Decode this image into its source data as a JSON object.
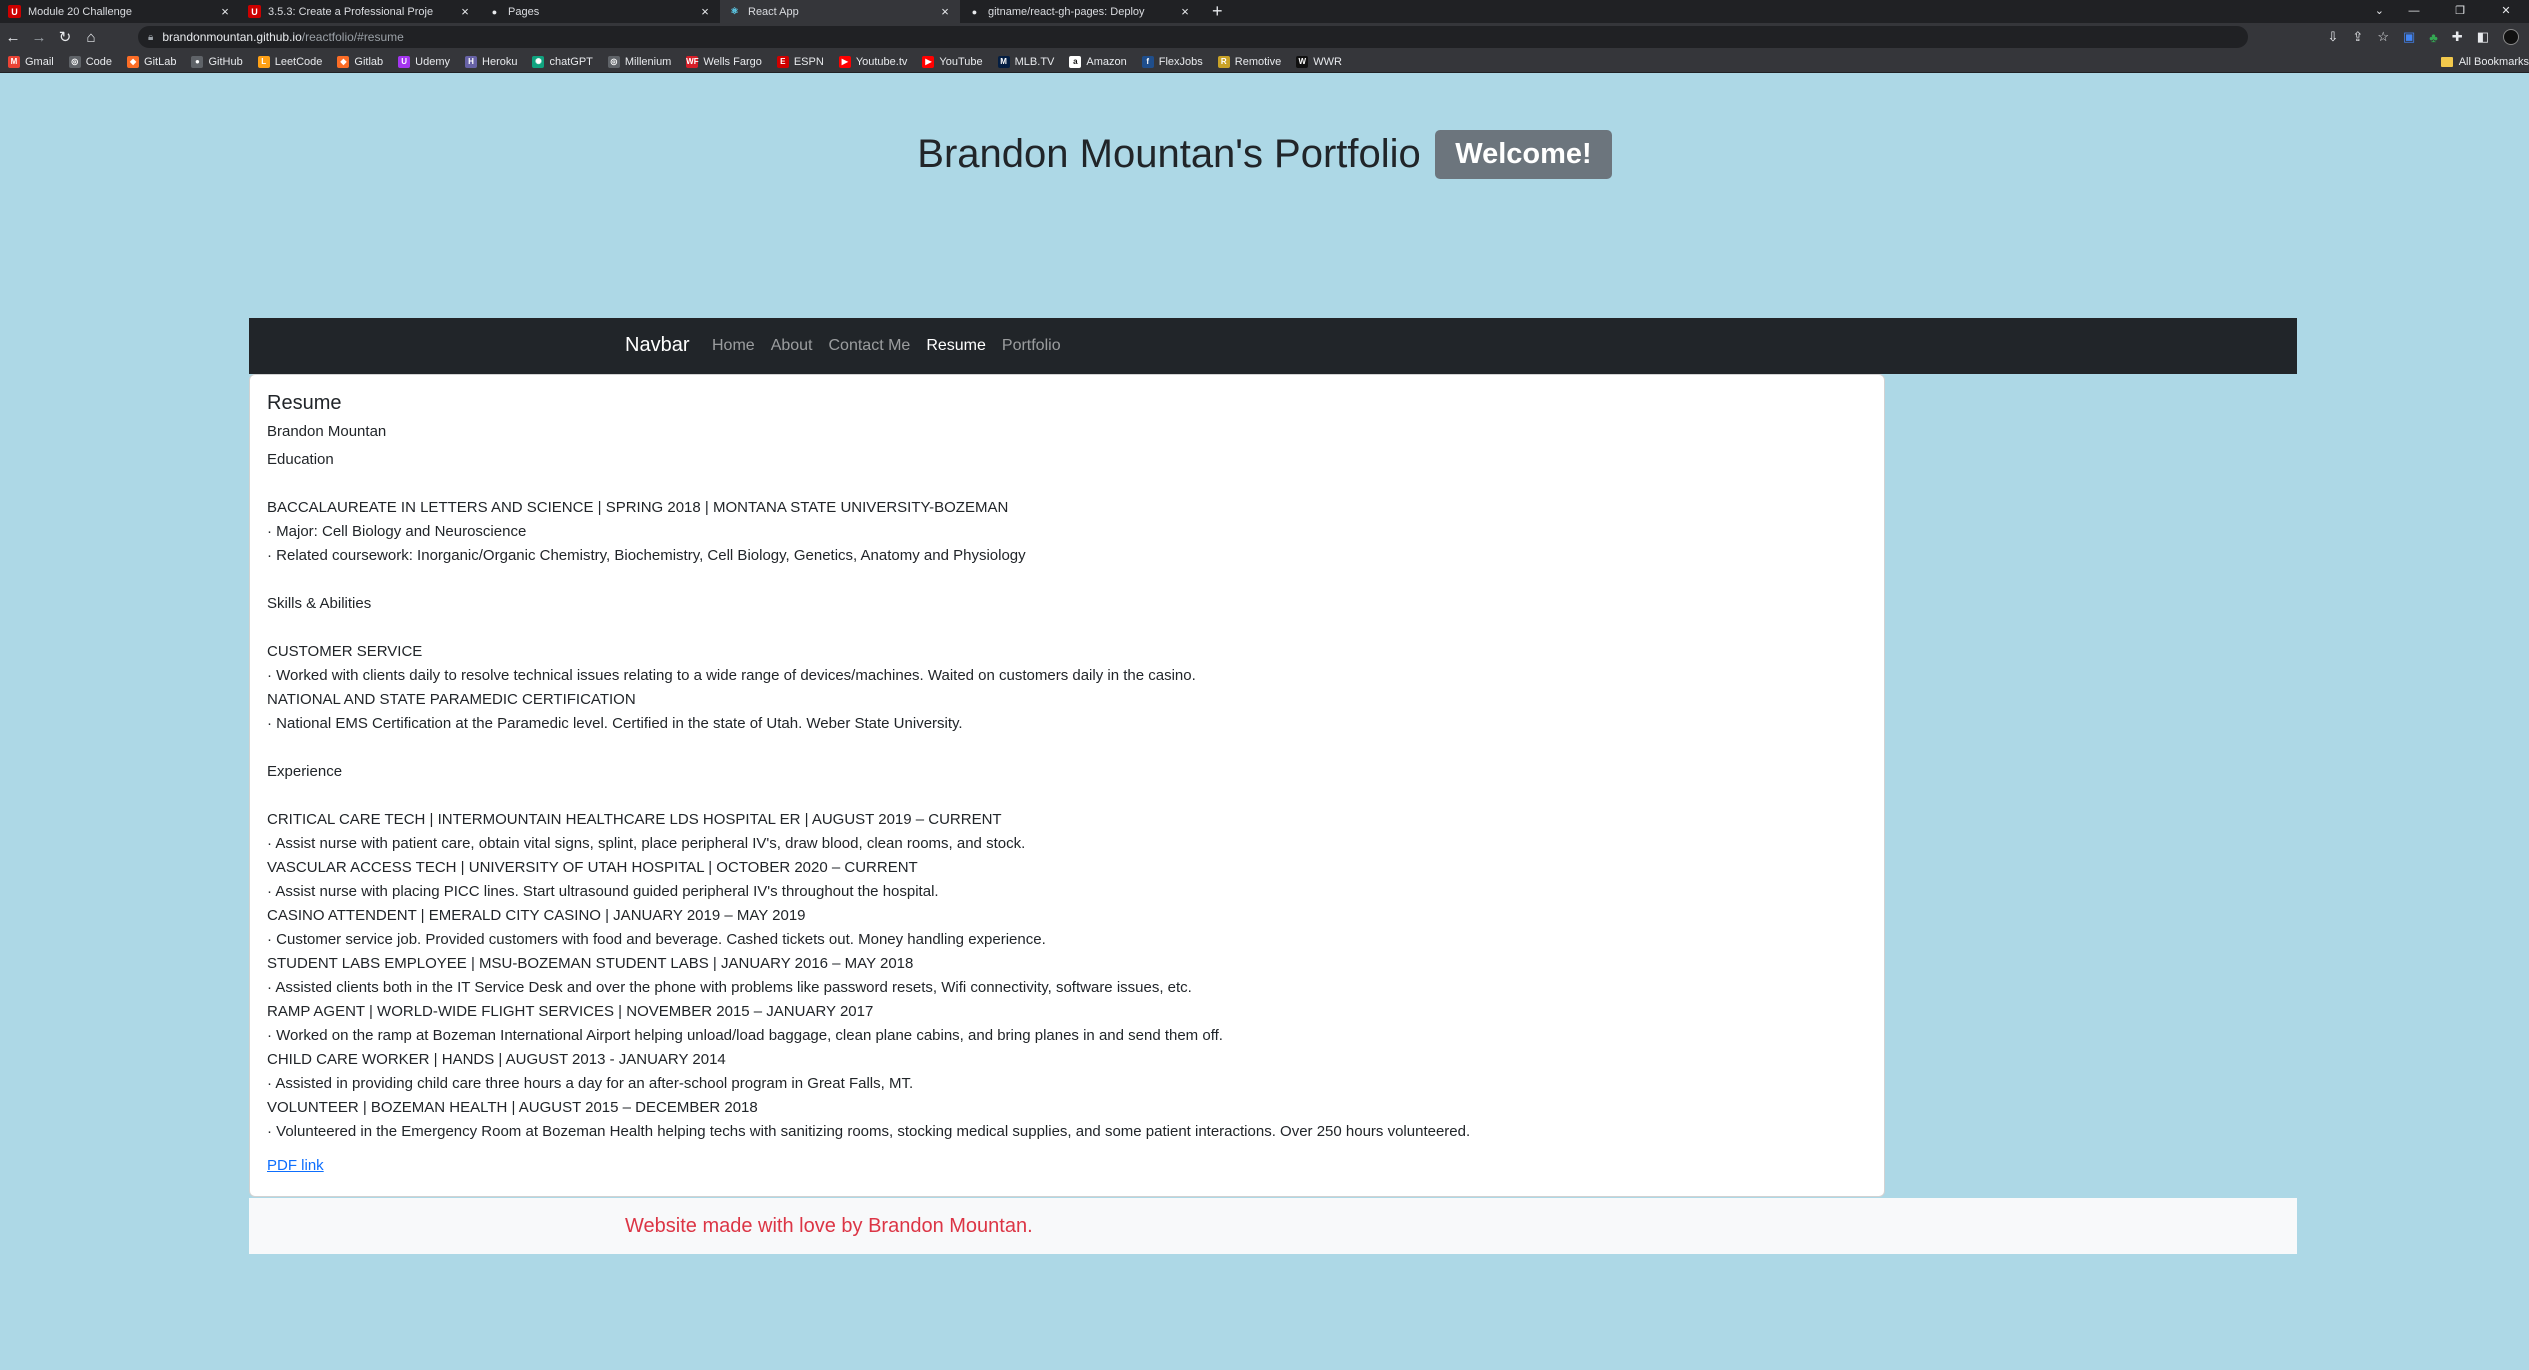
{
  "browser": {
    "tabs": [
      {
        "title": "Module 20 Challenge",
        "icon": "u-logo",
        "color": "#cc0000",
        "glyph": "U"
      },
      {
        "title": "3.5.3: Create a Professional Proje",
        "icon": "u-logo",
        "color": "#cc0000",
        "glyph": "U"
      },
      {
        "title": "Pages",
        "icon": "github-icon",
        "color": "#e8eaed",
        "glyph": "●"
      },
      {
        "title": "React App",
        "icon": "react-icon",
        "color": "#61dafb",
        "glyph": "⚛"
      },
      {
        "title": "gitname/react-gh-pages: Deploy",
        "icon": "github-icon",
        "color": "#e8eaed",
        "glyph": "●"
      }
    ],
    "new_tab": "+",
    "url_host": "brandonmountan.github.io",
    "url_path": "/reactfolio/#resume",
    "bookmarks": [
      {
        "label": "Gmail",
        "color": "#ea4335",
        "glyph": "M"
      },
      {
        "label": "Code",
        "color": "#5f6368",
        "glyph": "◎"
      },
      {
        "label": "GitLab",
        "color": "#fc6d26",
        "glyph": "◆"
      },
      {
        "label": "GitHub",
        "color": "#5f6368",
        "glyph": "●"
      },
      {
        "label": "LeetCode",
        "color": "#ffa116",
        "glyph": "L"
      },
      {
        "label": "Gitlab",
        "color": "#fc6d26",
        "glyph": "◆"
      },
      {
        "label": "Udemy",
        "color": "#a435f0",
        "glyph": "U"
      },
      {
        "label": "Heroku",
        "color": "#6762a6",
        "glyph": "H"
      },
      {
        "label": "chatGPT",
        "color": "#10a37f",
        "glyph": "✺"
      },
      {
        "label": "Millenium",
        "color": "#5f6368",
        "glyph": "◎"
      },
      {
        "label": "Wells Fargo",
        "color": "#d71e28",
        "glyph": "WF"
      },
      {
        "label": "ESPN",
        "color": "#d00000",
        "glyph": "E"
      },
      {
        "label": "Youtube.tv",
        "color": "#ff0000",
        "glyph": "▶"
      },
      {
        "label": "YouTube",
        "color": "#ff0000",
        "glyph": "▶"
      },
      {
        "label": "MLB.TV",
        "color": "#041e42",
        "glyph": "M"
      },
      {
        "label": "Amazon",
        "color": "#ffffff",
        "glyph": "a"
      },
      {
        "label": "FlexJobs",
        "color": "#1f4e8c",
        "glyph": "f"
      },
      {
        "label": "Remotive",
        "color": "#c9a227",
        "glyph": "R"
      },
      {
        "label": "WWR",
        "color": "#111111",
        "glyph": "W"
      }
    ],
    "all_bookmarks": "All Bookmarks"
  },
  "header": {
    "title": "Brandon Mountan's Portfolio",
    "badge": "Welcome!"
  },
  "navbar": {
    "brand": "Navbar",
    "links": [
      {
        "label": "Home",
        "active": false
      },
      {
        "label": "About",
        "active": false
      },
      {
        "label": "Contact Me",
        "active": false
      },
      {
        "label": "Resume",
        "active": true
      },
      {
        "label": "Portfolio",
        "active": false
      }
    ]
  },
  "resume": {
    "title": "Resume",
    "name": "Brandon Mountan",
    "lines": [
      "Education",
      "",
      "BACCALAUREATE IN LETTERS AND SCIENCE | SPRING 2018 | MONTANA STATE UNIVERSITY-BOZEMAN",
      "· Major: Cell Biology and Neuroscience",
      "· Related coursework: Inorganic/Organic Chemistry, Biochemistry, Cell Biology, Genetics, Anatomy and Physiology",
      "",
      "Skills & Abilities",
      "",
      "CUSTOMER SERVICE",
      "· Worked with clients daily to resolve technical issues relating to a wide range of devices/machines. Waited on customers daily in the casino.",
      "NATIONAL AND STATE PARAMEDIC CERTIFICATION",
      "· National EMS Certification at the Paramedic level. Certified in the state of Utah. Weber State University.",
      "",
      "Experience",
      "",
      "CRITICAL CARE TECH | INTERMOUNTAIN HEALTHCARE LDS HOSPITAL ER | AUGUST 2019 – CURRENT",
      "· Assist nurse with patient care, obtain vital signs, splint, place peripheral IV's, draw blood, clean rooms, and stock.",
      "VASCULAR ACCESS TECH | UNIVERSITY OF UTAH HOSPITAL | OCTOBER 2020 – CURRENT",
      "· Assist nurse with placing PICC lines. Start ultrasound guided peripheral IV's throughout the hospital.",
      "CASINO ATTENDENT | EMERALD CITY CASINO | JANUARY 2019 – MAY 2019",
      "· Customer service job. Provided customers with food and beverage. Cashed tickets out. Money handling experience.",
      "STUDENT LABS EMPLOYEE | MSU-BOZEMAN STUDENT LABS | JANUARY 2016 – MAY 2018",
      "· Assisted clients both in the IT Service Desk and over the phone with problems like password resets, Wifi connectivity, software issues, etc.",
      "RAMP AGENT | WORLD-WIDE FLIGHT SERVICES | NOVEMBER 2015 – JANUARY 2017",
      "· Worked on the ramp at Bozeman International Airport helping unload/load baggage, clean plane cabins, and bring planes in and send them off.",
      "CHILD CARE WORKER | HANDS | AUGUST 2013 - JANUARY 2014",
      "· Assisted in providing child care three hours a day for an after-school program in Great Falls, MT.",
      "VOLUNTEER | BOZEMAN HEALTH | AUGUST 2015 – DECEMBER 2018",
      "· Volunteered in the Emergency Room at Bozeman Health helping techs with sanitizing rooms, stocking medical supplies, and some patient interactions. Over 250 hours volunteered."
    ],
    "pdf_link": "PDF link"
  },
  "footer": {
    "message": "Website made with love by Brandon Mountan."
  }
}
